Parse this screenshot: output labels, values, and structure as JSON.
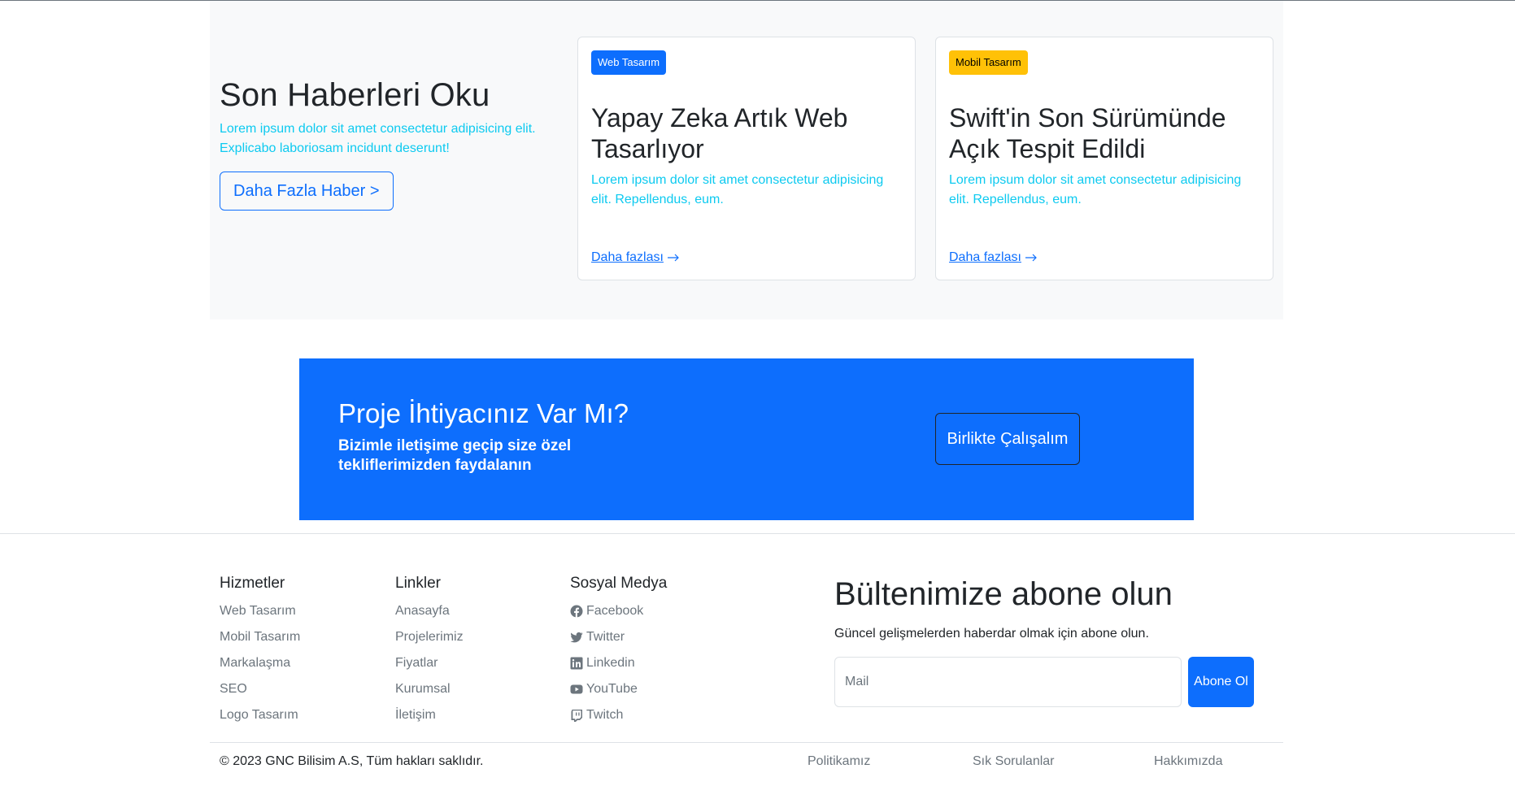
{
  "news": {
    "title": "Son Haberleri Oku",
    "description": "Lorem ipsum dolor sit amet consectetur adipisicing elit. Explicabo laboriosam incidunt deserunt!",
    "more_button": "Daha Fazla Haber >",
    "cards": [
      {
        "badge": "Web Tasarım",
        "badge_color": "#0d6efd",
        "title": "Yapay Zeka Artık Web Tasarlıyor",
        "text": "Lorem ipsum dolor sit amet consectetur adipisicing elit. Repellendus, eum.",
        "link": "Daha fazlası"
      },
      {
        "badge": "Mobil Tasarım",
        "badge_color": "#ffc107",
        "title": "Swift'in Son Sürümünde Açık Tespit Edildi",
        "text": "Lorem ipsum dolor sit amet consectetur adipisicing elit. Repellendus, eum.",
        "link": "Daha fazlası"
      }
    ]
  },
  "cta": {
    "title": "Proje İhtiyacınız Var Mı?",
    "subtitle": "Bizimle iletişime geçip size özel tekliflerimizden faydalanın",
    "button": "Birlikte Çalışalım",
    "background": "#0d6efd"
  },
  "footer": {
    "services": {
      "heading": "Hizmetler",
      "items": [
        "Web Tasarım",
        "Mobil Tasarım",
        "Markalaşma",
        "SEO",
        "Logo Tasarım"
      ]
    },
    "links": {
      "heading": "Linkler",
      "items": [
        "Anasayfa",
        "Projelerimiz",
        "Fiyatlar",
        "Kurumsal",
        "İletişim"
      ]
    },
    "social": {
      "heading": "Sosyal Medya",
      "items": [
        {
          "label": "Facebook",
          "icon": "facebook-icon"
        },
        {
          "label": "Twitter",
          "icon": "twitter-icon"
        },
        {
          "label": "Linkedin",
          "icon": "linkedin-icon"
        },
        {
          "label": "YouTube",
          "icon": "youtube-icon"
        },
        {
          "label": "Twitch",
          "icon": "twitch-icon"
        }
      ]
    },
    "newsletter": {
      "title": "Bültenimize abone olun",
      "description": "Güncel gelişmelerden haberdar olmak için abone olun.",
      "placeholder": "Mail",
      "button": "Abone Ol"
    },
    "copyright": "© 2023 GNC Bilisim A.S, Tüm hakları saklıdır.",
    "bottom_links": [
      "Politikamız",
      "Sık Sorulanlar",
      "Hakkımızda"
    ]
  },
  "colors": {
    "primary": "#0d6efd",
    "info": "#0dcaf0",
    "warning": "#ffc107",
    "muted": "#6c757d"
  }
}
